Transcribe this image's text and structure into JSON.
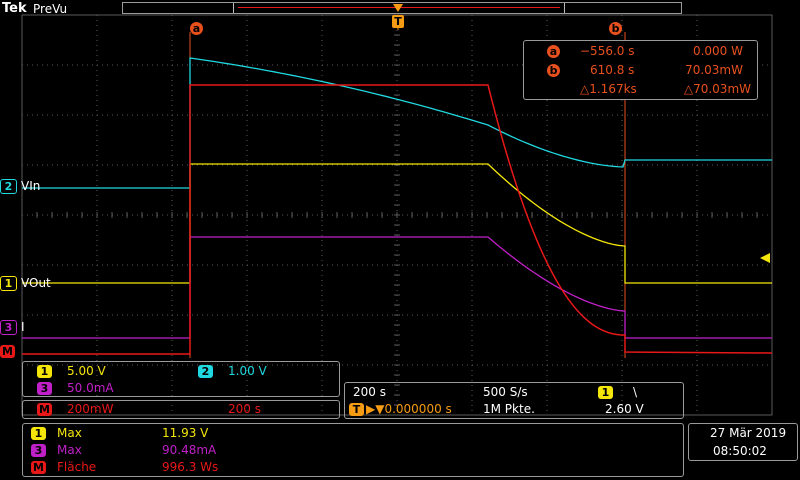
{
  "colors": {
    "ch1": "#f5e60a",
    "ch2": "#20d8e0",
    "ch3": "#c020c8",
    "math": "#e81818",
    "cursor": "#e8501e",
    "trigger": "#f59b14",
    "grid": "#5a5a5a",
    "border": "#9a9a9a"
  },
  "header": {
    "brand": "Tek",
    "mode": "PreVu"
  },
  "trigger_marker": {
    "label": "T"
  },
  "cursor_markers": {
    "a": "a",
    "b": "b"
  },
  "cursor_readout": {
    "a_time": "−556.0 s",
    "a_value": "0.000 W",
    "b_time": "610.8 s",
    "b_value": "70.03mW",
    "delta_time": "△1.167ks",
    "delta_value": "△70.03mW"
  },
  "channels": [
    {
      "number": "2",
      "label": "VIn",
      "color": "#20d8e0"
    },
    {
      "number": "1",
      "label": "VOut",
      "color": "#f5e60a"
    },
    {
      "number": "3",
      "label": "I",
      "color": "#c020c8"
    },
    {
      "number": "M",
      "label": "",
      "color": "#e81818"
    }
  ],
  "scale_panel": {
    "ch1_num": "1",
    "ch1_scale": "5.00 V",
    "ch2_num": "2",
    "ch2_scale": "1.00 V",
    "ch3_num": "3",
    "ch3_scale": "50.0mA",
    "math_num": "M",
    "math_scale": "200mW",
    "math_time": "200 s"
  },
  "timebase": {
    "horizontal": "200 s",
    "sample_rate": "500 S/s",
    "trigger_source": "1",
    "trigger_slope": "\\",
    "trigger_position": "▶▼0.000000 s",
    "trigger_pos_icon": "T",
    "record_length": "1M Pkte.",
    "trigger_level": "2.60 V"
  },
  "measurements": [
    {
      "source": "1",
      "name": "Max",
      "value": "11.93 V",
      "color": "#f5e60a"
    },
    {
      "source": "3",
      "name": "Max",
      "value": "90.48mA",
      "color": "#c020c8"
    },
    {
      "source": "M",
      "name": "Fläche",
      "value": "996.3 Ws",
      "color": "#e81818"
    }
  ],
  "datetime": {
    "date": "27 Mär  2019",
    "time": "08:50:02"
  }
}
